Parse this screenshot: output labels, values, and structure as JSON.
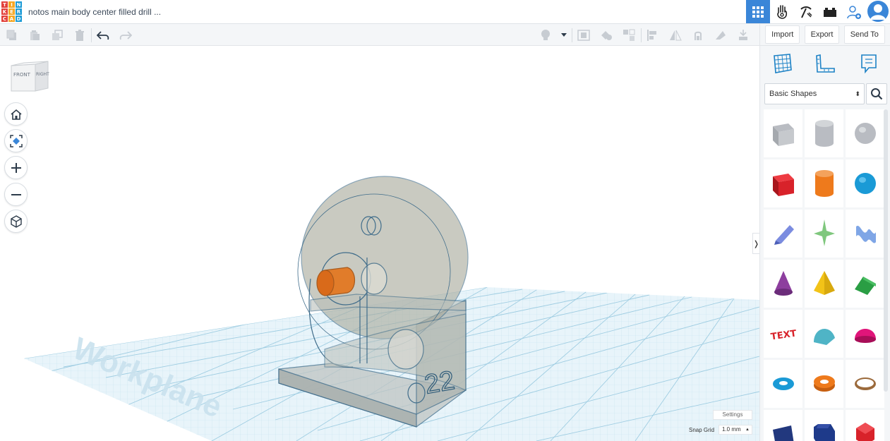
{
  "app": {
    "logo_letters": [
      "T",
      "I",
      "N",
      "K",
      "E",
      "R",
      "C",
      "A",
      "D"
    ],
    "logo_colors": [
      "#e2403a",
      "#f5a623",
      "#1d9bd6",
      "#e2403a",
      "#f5a623",
      "#1d9bd6",
      "#e2403a",
      "#f5a623",
      "#1d9bd6"
    ],
    "document_title": "notos main body center filled drill ...",
    "accent_color": "#3a86d8"
  },
  "top_nav": {
    "icons": [
      "3d-design-grid-icon",
      "circuits-hand-icon",
      "pickaxe-icon",
      "bricks-icon",
      "invite-user-icon",
      "user-avatar-icon"
    ]
  },
  "toolbar": {
    "left_tools": [
      "copy-icon",
      "paste-icon",
      "duplicate-icon",
      "delete-icon",
      "undo-icon",
      "redo-icon"
    ],
    "right_tools": [
      "light-bulb-icon",
      "dropdown-icon",
      "group-icon",
      "ungroup-icon",
      "hole-icon",
      "align-icon",
      "mirror-icon",
      "cruise-icon",
      "flip-icon",
      "drop-icon"
    ]
  },
  "actions": {
    "import": "Import",
    "export": "Export",
    "send_to": "Send To"
  },
  "viewcube": {
    "front": "FRONT",
    "right": "RIGHT"
  },
  "workplane": {
    "label": "Workplane",
    "number_label": "22"
  },
  "settings": {
    "settings_label": "Settings",
    "snap_grid_label": "Snap Grid",
    "snap_grid_value": "1.0 mm"
  },
  "panel": {
    "tabs": [
      "workplane-icon",
      "ruler-icon",
      "notes-icon"
    ],
    "library": "Basic Shapes",
    "shapes": [
      {
        "name": "box-hole",
        "color": "#b9bcc2"
      },
      {
        "name": "cylinder-hole",
        "color": "#b9bcc2"
      },
      {
        "name": "sphere-hole",
        "color": "#b9bcc2"
      },
      {
        "name": "box",
        "color": "#d8222a"
      },
      {
        "name": "cylinder",
        "color": "#ee7a1c"
      },
      {
        "name": "sphere",
        "color": "#1a9ad6"
      },
      {
        "name": "scribble",
        "color": "#7b8ce0"
      },
      {
        "name": "graphic",
        "color": "#7fc77d"
      },
      {
        "name": "shape-generators",
        "color": "#7fa6e6"
      },
      {
        "name": "cone",
        "color": "#8d3e9e"
      },
      {
        "name": "pyramid",
        "color": "#f2c318"
      },
      {
        "name": "roof",
        "color": "#2a9e44"
      },
      {
        "name": "text",
        "color": "#d8222a"
      },
      {
        "name": "round-roof",
        "color": "#4fb4c6"
      },
      {
        "name": "half-sphere",
        "color": "#e0157a"
      },
      {
        "name": "torus",
        "color": "#1a9ad6"
      },
      {
        "name": "tube",
        "color": "#ee7a1c"
      },
      {
        "name": "ring",
        "color": "#9b6a3b"
      },
      {
        "name": "wedge",
        "color": "#22387e"
      },
      {
        "name": "polygon",
        "color": "#1e3a8a"
      },
      {
        "name": "icosahedron",
        "color": "#d8222a"
      }
    ]
  }
}
